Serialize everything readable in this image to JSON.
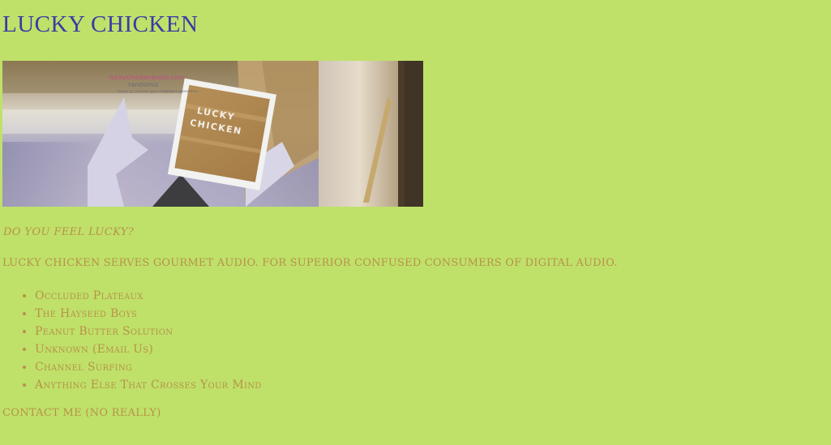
{
  "site": {
    "title": "LUCKY CHICKEN"
  },
  "banner": {
    "sign_text": "LUCKY CHICKEN",
    "watermark_url": "luckychickenaudio.com",
    "watermark_sub": "randomiz",
    "watermark_small": "music to confuse your neighbors speechless"
  },
  "tagline": "DO YOU FEEL LUCKY?",
  "intro": "LUCKY CHICKEN SERVES GOURMET AUDIO. FOR SUPERIOR CONFUSED CONSUMERS OF DIGITAL AUDIO.",
  "links": [
    "Occluded Plateaux",
    "The Hayseed Boys",
    "Peanut Butter Solution",
    "Unknown (Email Us)",
    "Channel Surfing",
    "Anything Else That Crosses Your Mind"
  ],
  "contact": "CONTACT ME (NO REALLY)",
  "colors": {
    "background": "#bfe169",
    "title": "#3a3aa6",
    "text": "#b8914a"
  }
}
